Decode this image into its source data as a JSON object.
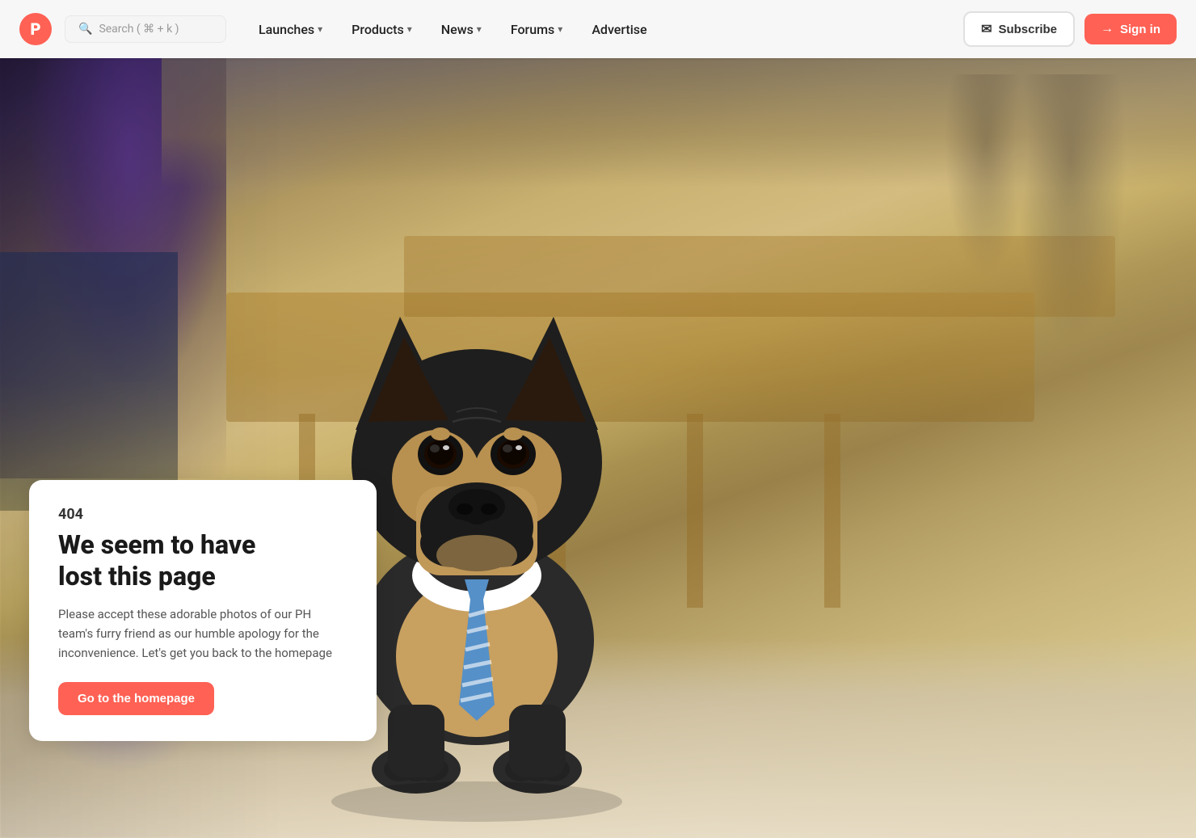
{
  "navbar": {
    "logo_letter": "P",
    "search_placeholder": "Search ( ⌘ + k )",
    "nav_items": [
      {
        "id": "launches",
        "label": "Launches",
        "has_dropdown": true
      },
      {
        "id": "products",
        "label": "Products",
        "has_dropdown": true
      },
      {
        "id": "news",
        "label": "News",
        "has_dropdown": true
      },
      {
        "id": "forums",
        "label": "Forums",
        "has_dropdown": true
      },
      {
        "id": "advertise",
        "label": "Advertise",
        "has_dropdown": false
      }
    ],
    "subscribe_label": "Subscribe",
    "signin_label": "Sign in"
  },
  "error_page": {
    "error_code": "404",
    "title_line1": "We seem to have",
    "title_line2": "lost this page",
    "description": "Please accept these adorable photos of our PH team's furry friend as our humble apology for the inconvenience. Let's get you back to the homepage",
    "cta_label": "Go to the homepage"
  },
  "colors": {
    "brand": "#ff6154",
    "nav_bg": "rgba(255,255,255,0.97)",
    "card_bg": "#ffffff"
  }
}
